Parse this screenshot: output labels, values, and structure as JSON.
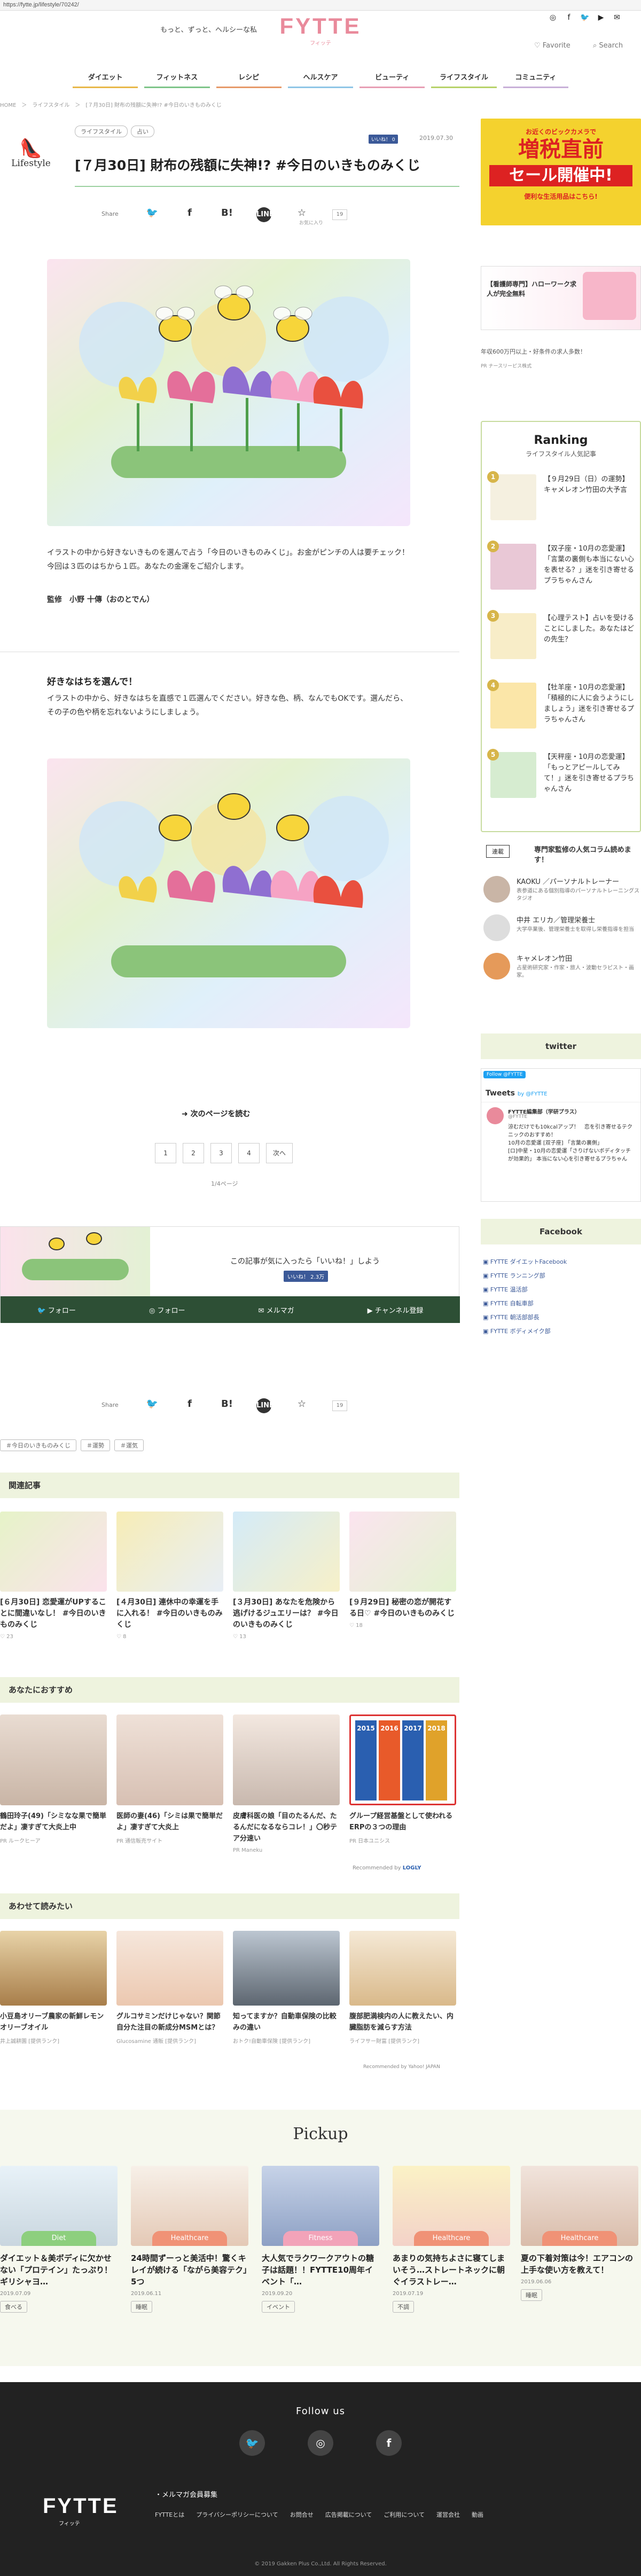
{
  "browser": {
    "url": "https://fytte.jp/lifestyle/70242/"
  },
  "header": {
    "tagline": "もっと、ずっと、ヘルシーな私",
    "logo": "FYTTE",
    "logo_sub": "フィッテ",
    "favorite_label": "Favorite",
    "search_label": "Search"
  },
  "nav": [
    {
      "label": "ダイエット",
      "color": "#e8b84a"
    },
    {
      "label": "フィットネス",
      "color": "#7fc58a"
    },
    {
      "label": "レシピ",
      "color": "#e69a6a"
    },
    {
      "label": "ヘルスケア",
      "color": "#8fc6e6"
    },
    {
      "label": "ビューティ",
      "color": "#e79fb4"
    },
    {
      "label": "ライフスタイル",
      "color": "#b7d26a"
    },
    {
      "label": "コミュニティ",
      "color": "#c8b0d8"
    }
  ],
  "breadcrumb": "HOME　＞　ライフスタイル　＞　[７月30日] 財布の残額に失神!? #今日のいきものみくじ",
  "article": {
    "category_logo": "Lifestyle",
    "tags": [
      "ライフスタイル",
      "占い"
    ],
    "like_badge": "いいね！ 0",
    "date": "2019.07.30",
    "title": "[７月30日] 財布の残額に失神!? #今日のいきものみくじ",
    "share_label": "Share",
    "share_save_label": "B!",
    "share_count": "19",
    "share_count_label": "お気に入り",
    "intro": "イラストの中から好きないきものを選んで占う「今日のいきものみくじ」。お金がピンチの人は要チェック！　今回は３匹のはちから１匹。あなたの金運をご紹介します。",
    "supervisor_label": "監修",
    "supervisor": "小野 十傳（おのとでん）",
    "section_heading": "好きなはちを選んで！",
    "section_text": "イラストの中から、好きなはちを直感で１匹選んでください。好きな色、柄、なんでもOKです。選んだら、その子の色や柄を忘れないようにしましょう。",
    "next_page": "次のページを読む",
    "pages": [
      "1",
      "2",
      "3",
      "4",
      "次へ"
    ],
    "page_indicator": "1/4ページ",
    "like_prompt": "この記事が気に入ったら「いいね！」しよう",
    "like_prompt_badge": "いいね！ 2.3万",
    "follow_row": [
      "フォロー",
      "フォロー",
      "メルマガ",
      "チャンネル登録"
    ],
    "hashtags": [
      "今日のいきものみくじ",
      "運勢",
      "運気"
    ]
  },
  "related": {
    "heading": "関連記事",
    "items": [
      {
        "title": "[６月30日] 恋愛運がUPすることに間違いなし！ #今日のいきものみくじ",
        "count": "23"
      },
      {
        "title": "[４月30日] 連休中の幸運を手に入れる！ #今日のいきものみくじ",
        "count": "8"
      },
      {
        "title": "[３月30日] あなたを危険から逃げけるジュエリーは？ #今日のいきものみくじ",
        "count": "13"
      },
      {
        "title": "[９月29日] 秘密の恋が開花する日♡ #今日のいきものみくじ",
        "count": "18"
      }
    ]
  },
  "recommend": {
    "heading": "あなたにおすすめ",
    "items": [
      {
        "title": "鶴田玲子(49)「シミなな果で簡単だよ」凄すぎて大炎上中",
        "source": "PR ルークヒーア"
      },
      {
        "title": "医師の妻(46)「シミは果で簡単だよ」凄すぎて大炎上",
        "source": "PR 通信販売サイト"
      },
      {
        "title": "皮膚科医の娘「目のたるんだ、たるんだになるならコレ！」〇秒テア分速い",
        "source": "PR Maneku"
      },
      {
        "title": "グループ経営基盤として使われるERPの３つの理由",
        "source": "PR 日本ユニシス"
      }
    ],
    "recommended_by": "Recommended by",
    "recommended_brand": "LOGLY",
    "folder_years": [
      "2015",
      "2016",
      "2017",
      "2018"
    ]
  },
  "alsoread": {
    "heading": "あわせて読みたい",
    "items": [
      {
        "title": "小豆島オリーブ農家の新鮮レモンオリーブオイル",
        "source": "井上誠耕園 [提供ランク]"
      },
      {
        "title": "グルコサミンだけじゃない？関節自分た注目の新成分MSMとは？",
        "source": "Glucosamine 通販 [提供ランク]"
      },
      {
        "title": "知ってますか？自動車保険の比較みの違い",
        "source": "おトク!自動車保険 [提供ランク]"
      },
      {
        "title": "腹部肥満検内の人に教えたい、内臓脂肪を減らす方法",
        "source": "ライフサー財富 [提供ランク]"
      }
    ],
    "recommended_by": "Recommended by Yahoo! JAPAN"
  },
  "sidebar": {
    "banner1": {
      "line1": "お近くのビックカメラで",
      "line2": "増税直前",
      "line3": "セール開催中!",
      "line4": "便利な生活用品はこちら!"
    },
    "banner2": {
      "title": "【看護師専門】ハローワーク求人が完全無料",
      "text": "年収600万円以上・好条件の求人多数！",
      "pr": "PR ナースリーピス株式"
    },
    "ranking": {
      "title": "Ranking",
      "subtitle": "ライフスタイル人気記事",
      "items": [
        {
          "title": "【９月29日（日）の運勢】キャメレオン竹田の大予言"
        },
        {
          "title": "【双子座・10月の恋愛運】「言葉の裏側も本当にない心を表せる？」迷を引き寄せるプラちゃんさん"
        },
        {
          "title": "【心理テスト】占いを受けることにしました。あなたはどの先生？"
        },
        {
          "title": "【牡羊座・10月の恋愛運】「積極的に人に会うようにしましょう」迷を引き寄せるプラちゃんさん"
        },
        {
          "title": "【天秤座・10月の恋愛運】「もっとアピールしてみて！」迷を引き寄せるプラちゃんさん"
        }
      ]
    },
    "columnists": {
      "badge": "連載",
      "title": "専門家監修の人気コラム読めます！",
      "items": [
        {
          "name": "KAOKU ／パーソナルトレーナー",
          "desc": "表参道にある個別指導のパーソナルトレーニングスタジオ"
        },
        {
          "name": "中井 エリカ／管理栄養士",
          "desc": "大学卒業後、管理栄養士を取得し栄養指導を担当"
        },
        {
          "name": "キャメレオン竹田",
          "desc": "占星術研究家・作家・旅人・波動セラピスト・画家。"
        }
      ]
    },
    "twitter": {
      "heading": "twitter",
      "follow_btn": "Follow @FYTTE",
      "tweets_label": "Tweets",
      "tweets_by": "by @FYTTE",
      "account": "FYTTE編集部（学研プラス）",
      "handle": "@FYTTE",
      "tweet1": "涼むだけでも10kcalアップ！　恋を引き寄せるテクニックのおすすめ！",
      "tweet2": "10月の恋愛運 [双子座] 「言葉の裏側」",
      "tweet3": "[ロ]中星・10月の恋愛運「さりげないボディタッチが効果的」 本当にない心を引き寄せるプラちゃん"
    },
    "facebook": {
      "heading": "Facebook",
      "items": [
        "FYTTE ダイエットFacebook",
        "FYTTE ランニング部",
        "FYTTE 温活部",
        "FYTTE 自転車部",
        "FYTTE 朝活部部長",
        "FYTTE ボディメイク部"
      ]
    }
  },
  "pickup": {
    "heading": "Pickup",
    "items": [
      {
        "category": "Diet",
        "color": "#8dcf7e",
        "title": "ダイエット＆美ボディに欠かせない「プロテイン」たっぷり！ギリシャヨ…",
        "date": "2019.07.09",
        "tag": "食べる"
      },
      {
        "category": "Healthcare",
        "color": "#f09276",
        "title": "24時間ずーっと美活中！驚くキレイが続ける「ながら美容テク」5つ",
        "date": "2019.06.11",
        "tag": "睡眠"
      },
      {
        "category": "Fitness",
        "color": "#f2a3b9",
        "title": "大人気でラクワークアウトの糖子は話題！！FYTTE10周年イベント「…",
        "date": "2019.09.20",
        "tag": "イベント"
      },
      {
        "category": "Healthcare",
        "color": "#f09276",
        "title": "あまりの気持ちよさに寝てしまいそう…ストレートネックに朝ぐイラストレー…",
        "date": "2019.07.19",
        "tag": "不調"
      },
      {
        "category": "Healthcare",
        "color": "#f09276",
        "title": "夏の下着対策は今！エアコンの上手な使い方を教えて！",
        "date": "2019.06.06",
        "tag": "睡眠"
      }
    ]
  },
  "footer": {
    "follow_us": "Follow us",
    "logo": "FYTTE",
    "logo_sub": "フィッテ",
    "newsletter": "メルマガ会員募集",
    "links": [
      "FYTTEとは",
      "プライバシーポリシーについて",
      "お問合せ",
      "広告掲載について",
      "ご利用について",
      "運営会社",
      "動画"
    ],
    "copyright": "© 2019 Gakken Plus Co.,Ltd. All Rights Reserved."
  }
}
